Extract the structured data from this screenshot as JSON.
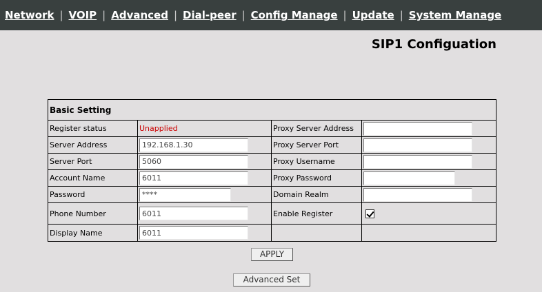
{
  "nav": {
    "items": [
      "Network",
      "VOIP",
      "Advanced",
      "Dial-peer",
      "Config Manage",
      "Update",
      "System Manage"
    ],
    "separator": "|"
  },
  "page_title": "SIP1 Configuation",
  "section_title": "Basic Setting",
  "left": {
    "register_status_label": "Register status",
    "register_status_value": "Unapplied",
    "server_address_label": "Server Address",
    "server_address_value": "192.168.1.30",
    "server_port_label": "Server Port",
    "server_port_value": "5060",
    "account_name_label": "Account Name",
    "account_name_value": "6011",
    "password_label": "Password",
    "password_value": "****",
    "phone_number_label": "Phone Number",
    "phone_number_value": "6011",
    "display_name_label": "Display Name",
    "display_name_value": "6011"
  },
  "right": {
    "proxy_server_address_label": "Proxy Server Address",
    "proxy_server_address_value": "",
    "proxy_server_port_label": "Proxy Server Port",
    "proxy_server_port_value": "",
    "proxy_username_label": "Proxy Username",
    "proxy_username_value": "",
    "proxy_password_label": "Proxy Password",
    "proxy_password_value": "",
    "domain_realm_label": "Domain Realm",
    "domain_realm_value": "",
    "enable_register_label": "Enable Register",
    "enable_register_checked": true
  },
  "buttons": {
    "apply": "APPLY",
    "advanced_set": "Advanced Set"
  },
  "colors": {
    "nav_bg": "#39403f",
    "page_bg": "#e1dfe0",
    "status_text": "#cc0000"
  }
}
